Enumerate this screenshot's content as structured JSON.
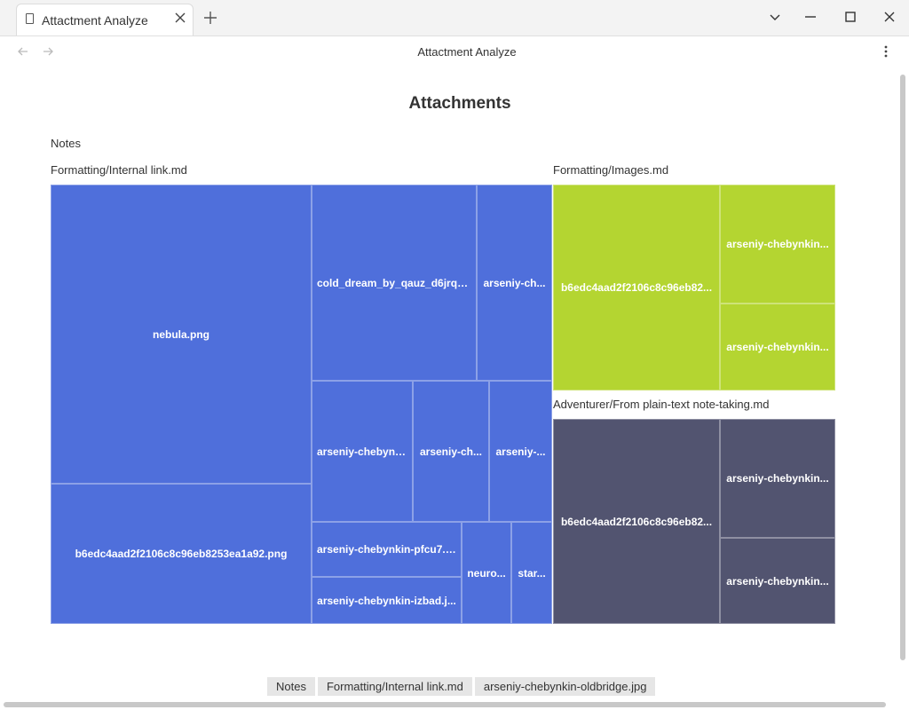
{
  "tab": {
    "title": "Attactment Analyze"
  },
  "nav": {
    "title": "Attactment Analyze"
  },
  "heading": "Attachments",
  "root_label": "Notes",
  "groups": [
    {
      "name": "Formatting/Internal link.md",
      "color": "#4f6fdb"
    },
    {
      "name": "Formatting/Images.md",
      "color": "#b4d531"
    },
    {
      "name": "Adventurer/From plain-text note-taking.md",
      "color": "#525470"
    }
  ],
  "cells": {
    "nebula": "nebula.png",
    "b6_long": "b6edc4aad2f2106c8c96eb8253ea1a92.png",
    "cold": "cold_dream_by_qauz_d6jrq8...",
    "ars1": "arseniy-ch...",
    "ars2": "arseniy-chebynk...",
    "ars3": "arseniy-ch...",
    "ars4": "arseniy-...",
    "pfcu": "arseniy-chebynkin-pfcu7.j...",
    "izbad": "arseniy-chebynkin-izbad.j...",
    "neuro": "neuro...",
    "star": "star...",
    "img_b6": "b6edc4aad2f2106c8c96eb82...",
    "img_a1": "arseniy-chebynkin...",
    "img_a2": "arseniy-chebynkin...",
    "adv_b6": "b6edc4aad2f2106c8c96eb82...",
    "adv_a1": "arseniy-chebynkin...",
    "adv_a2": "arseniy-chebynkin..."
  },
  "breadcrumb": [
    "Notes",
    "Formatting/Internal link.md",
    "arseniy-chebynkin-oldbridge.jpg"
  ]
}
